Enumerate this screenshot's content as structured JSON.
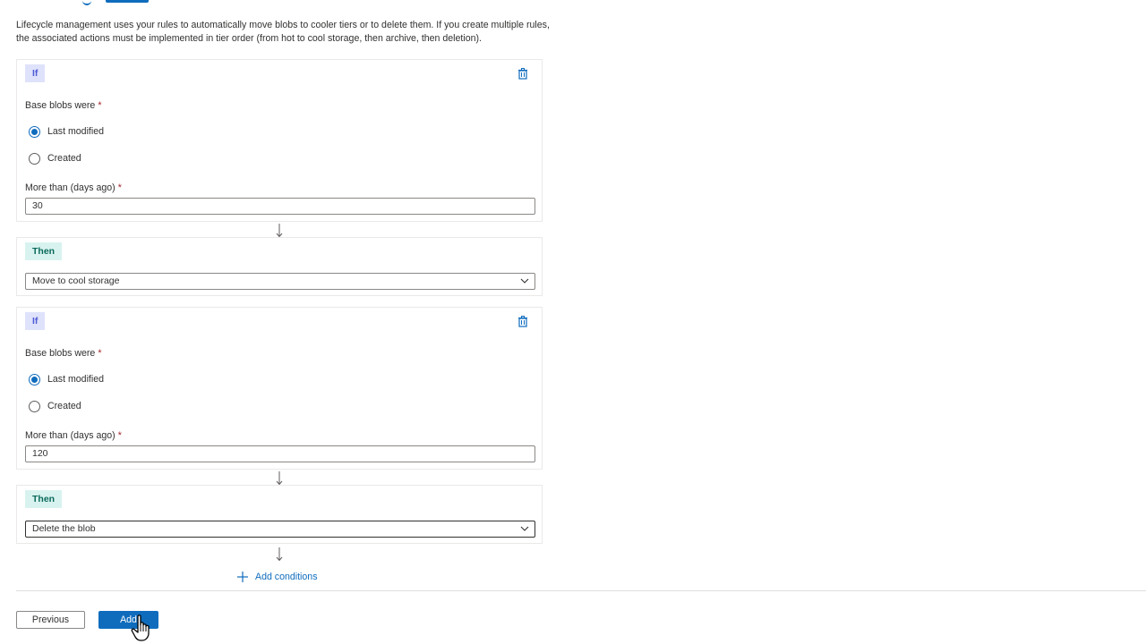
{
  "intro_text": "Lifecycle management uses your rules to automatically move blobs to cooler tiers or to delete them. If you create multiple rules, the associated actions must be implemented in tier order (from hot to cool storage, then archive, then deletion).",
  "rules": [
    {
      "if_label": "If",
      "base_blobs_label": "Base blobs were",
      "required_mark": "*",
      "option_last_modified": "Last modified",
      "option_created": "Created",
      "selected": "Last modified",
      "days_label": "More than (days ago)",
      "days_value": "30",
      "then_label": "Then",
      "action": "Move to cool storage"
    },
    {
      "if_label": "If",
      "base_blobs_label": "Base blobs were",
      "required_mark": "*",
      "option_last_modified": "Last modified",
      "option_created": "Created",
      "selected": "Last modified",
      "days_label": "More than (days ago)",
      "days_value": "120",
      "then_label": "Then",
      "action": "Delete the blob"
    }
  ],
  "add_conditions_label": "Add conditions",
  "footer": {
    "previous_label": "Previous",
    "add_label": "Add"
  },
  "icons": {
    "delete": "trash-icon",
    "arrow": "arrow-down-icon",
    "chevron": "chevron-down-icon",
    "add": "plus-icon",
    "cursor": "hand-pointer-icon"
  },
  "colors": {
    "accent": "#0f6cbd",
    "if_tag_bg": "#dfe2fb",
    "then_tag_bg": "#d8f3ef"
  }
}
